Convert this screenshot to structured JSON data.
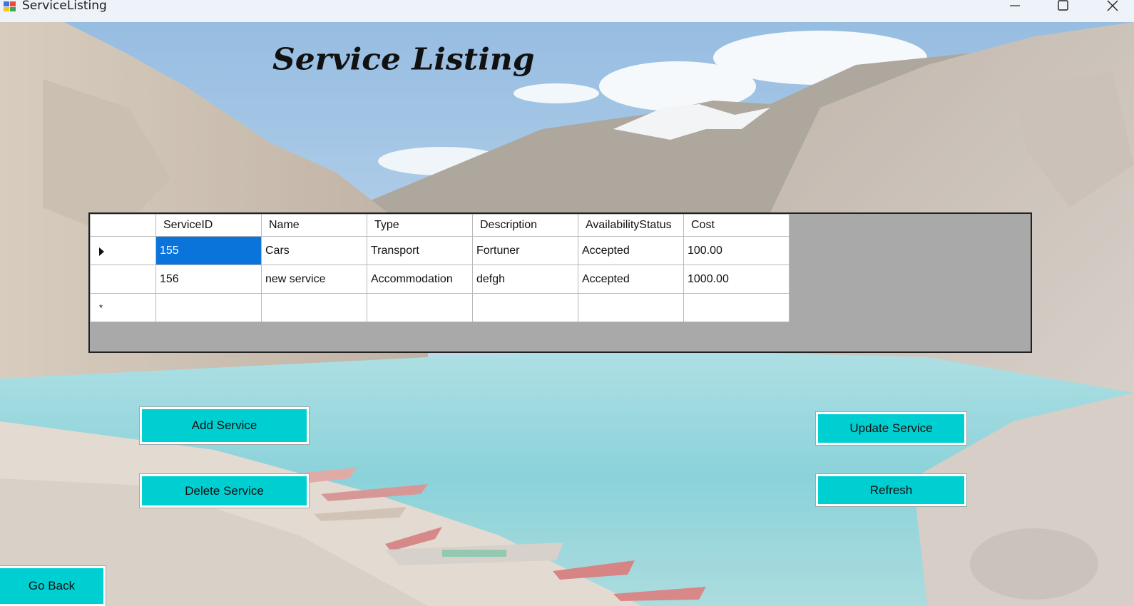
{
  "window": {
    "title": "ServiceListing"
  },
  "page": {
    "heading": "Service Listing"
  },
  "grid": {
    "columns": [
      "ServiceID",
      "Name",
      "Type",
      "Description",
      "AvailabilityStatus",
      "Cost"
    ],
    "rows": [
      {
        "ServiceID": "155",
        "Name": "Cars",
        "Type": "Transport",
        "Description": "Fortuner",
        "AvailabilityStatus": "Accepted",
        "Cost": "100.00"
      },
      {
        "ServiceID": "156",
        "Name": "new service",
        "Type": "Accommodation",
        "Description": "defgh",
        "AvailabilityStatus": "Accepted",
        "Cost": "1000.00"
      }
    ],
    "new_row_marker": "*",
    "selection_color": "#0a74da"
  },
  "buttons": {
    "add": "Add Service",
    "delete": "Delete Service",
    "update": "Update Service",
    "refresh": "Refresh",
    "go_back": "Go Back",
    "color": "#00cfd1"
  },
  "icons": {
    "app": "app-window-icon",
    "minimize": "minimize-icon",
    "maximize": "maximize-icon",
    "close": "close-icon"
  }
}
